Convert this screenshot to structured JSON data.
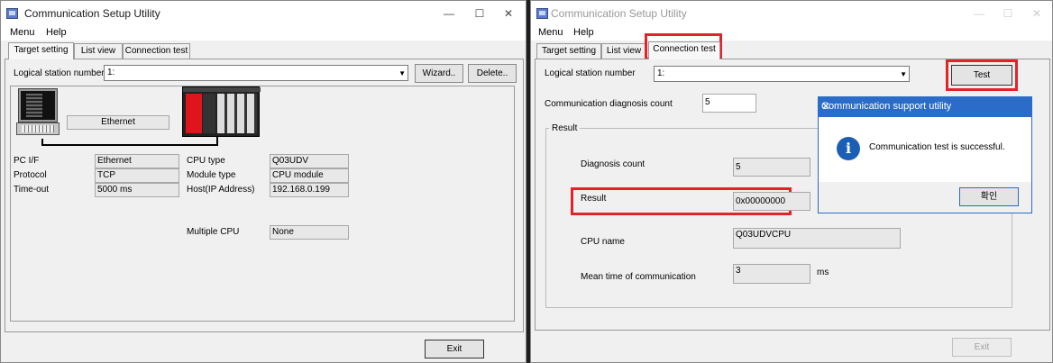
{
  "left_window": {
    "title": "Communication Setup Utility",
    "menu": [
      "Menu",
      "Help"
    ],
    "tabs": [
      "Target setting",
      "List view",
      "Connection test"
    ],
    "active_tab": "Target setting",
    "logical_station_label": "Logical station number",
    "logical_station_value": "1:",
    "wizard_button": "Wizard..",
    "delete_button": "Delete..",
    "network_label": "Ethernet",
    "pc_if_label": "PC I/F",
    "pc_if_value": "Ethernet",
    "protocol_label": "Protocol",
    "protocol_value": "TCP",
    "timeout_label": "Time-out",
    "timeout_value": "5000 ms",
    "cpu_type_label": "CPU type",
    "cpu_type_value": "Q03UDV",
    "module_type_label": "Module type",
    "module_type_value": "CPU module",
    "host_label": "Host(IP Address)",
    "host_value": "192.168.0.199",
    "multiple_cpu_label": "Multiple CPU",
    "multiple_cpu_value": "None",
    "exit_button": "Exit"
  },
  "right_window": {
    "title": "Communication Setup Utility",
    "menu": [
      "Menu",
      "Help"
    ],
    "tabs": [
      "Target setting",
      "List view",
      "Connection test"
    ],
    "active_tab": "Connection test",
    "logical_station_label": "Logical station number",
    "logical_station_value": "1:",
    "test_button": "Test",
    "diag_count_label": "Communication diagnosis count",
    "diag_count_value": "5",
    "result_group_label": "Result",
    "diagnosis_count_label": "Diagnosis count",
    "diagnosis_count_value": "5",
    "result_label": "Result",
    "result_value": "0x00000000",
    "cpu_name_label": "CPU name",
    "cpu_name_value": "Q03UDVCPU",
    "mean_time_label": "Mean time of communication",
    "mean_time_value": "3",
    "mean_time_unit": "ms",
    "exit_button": "Exit"
  },
  "dialog": {
    "title": "Communication support utility",
    "message": "Communication test is successful.",
    "ok_button": "확인"
  },
  "colors": {
    "highlight": "#e3222a",
    "dialog_title_bg": "#2a6cc7",
    "plc_red": "#e0141c"
  }
}
